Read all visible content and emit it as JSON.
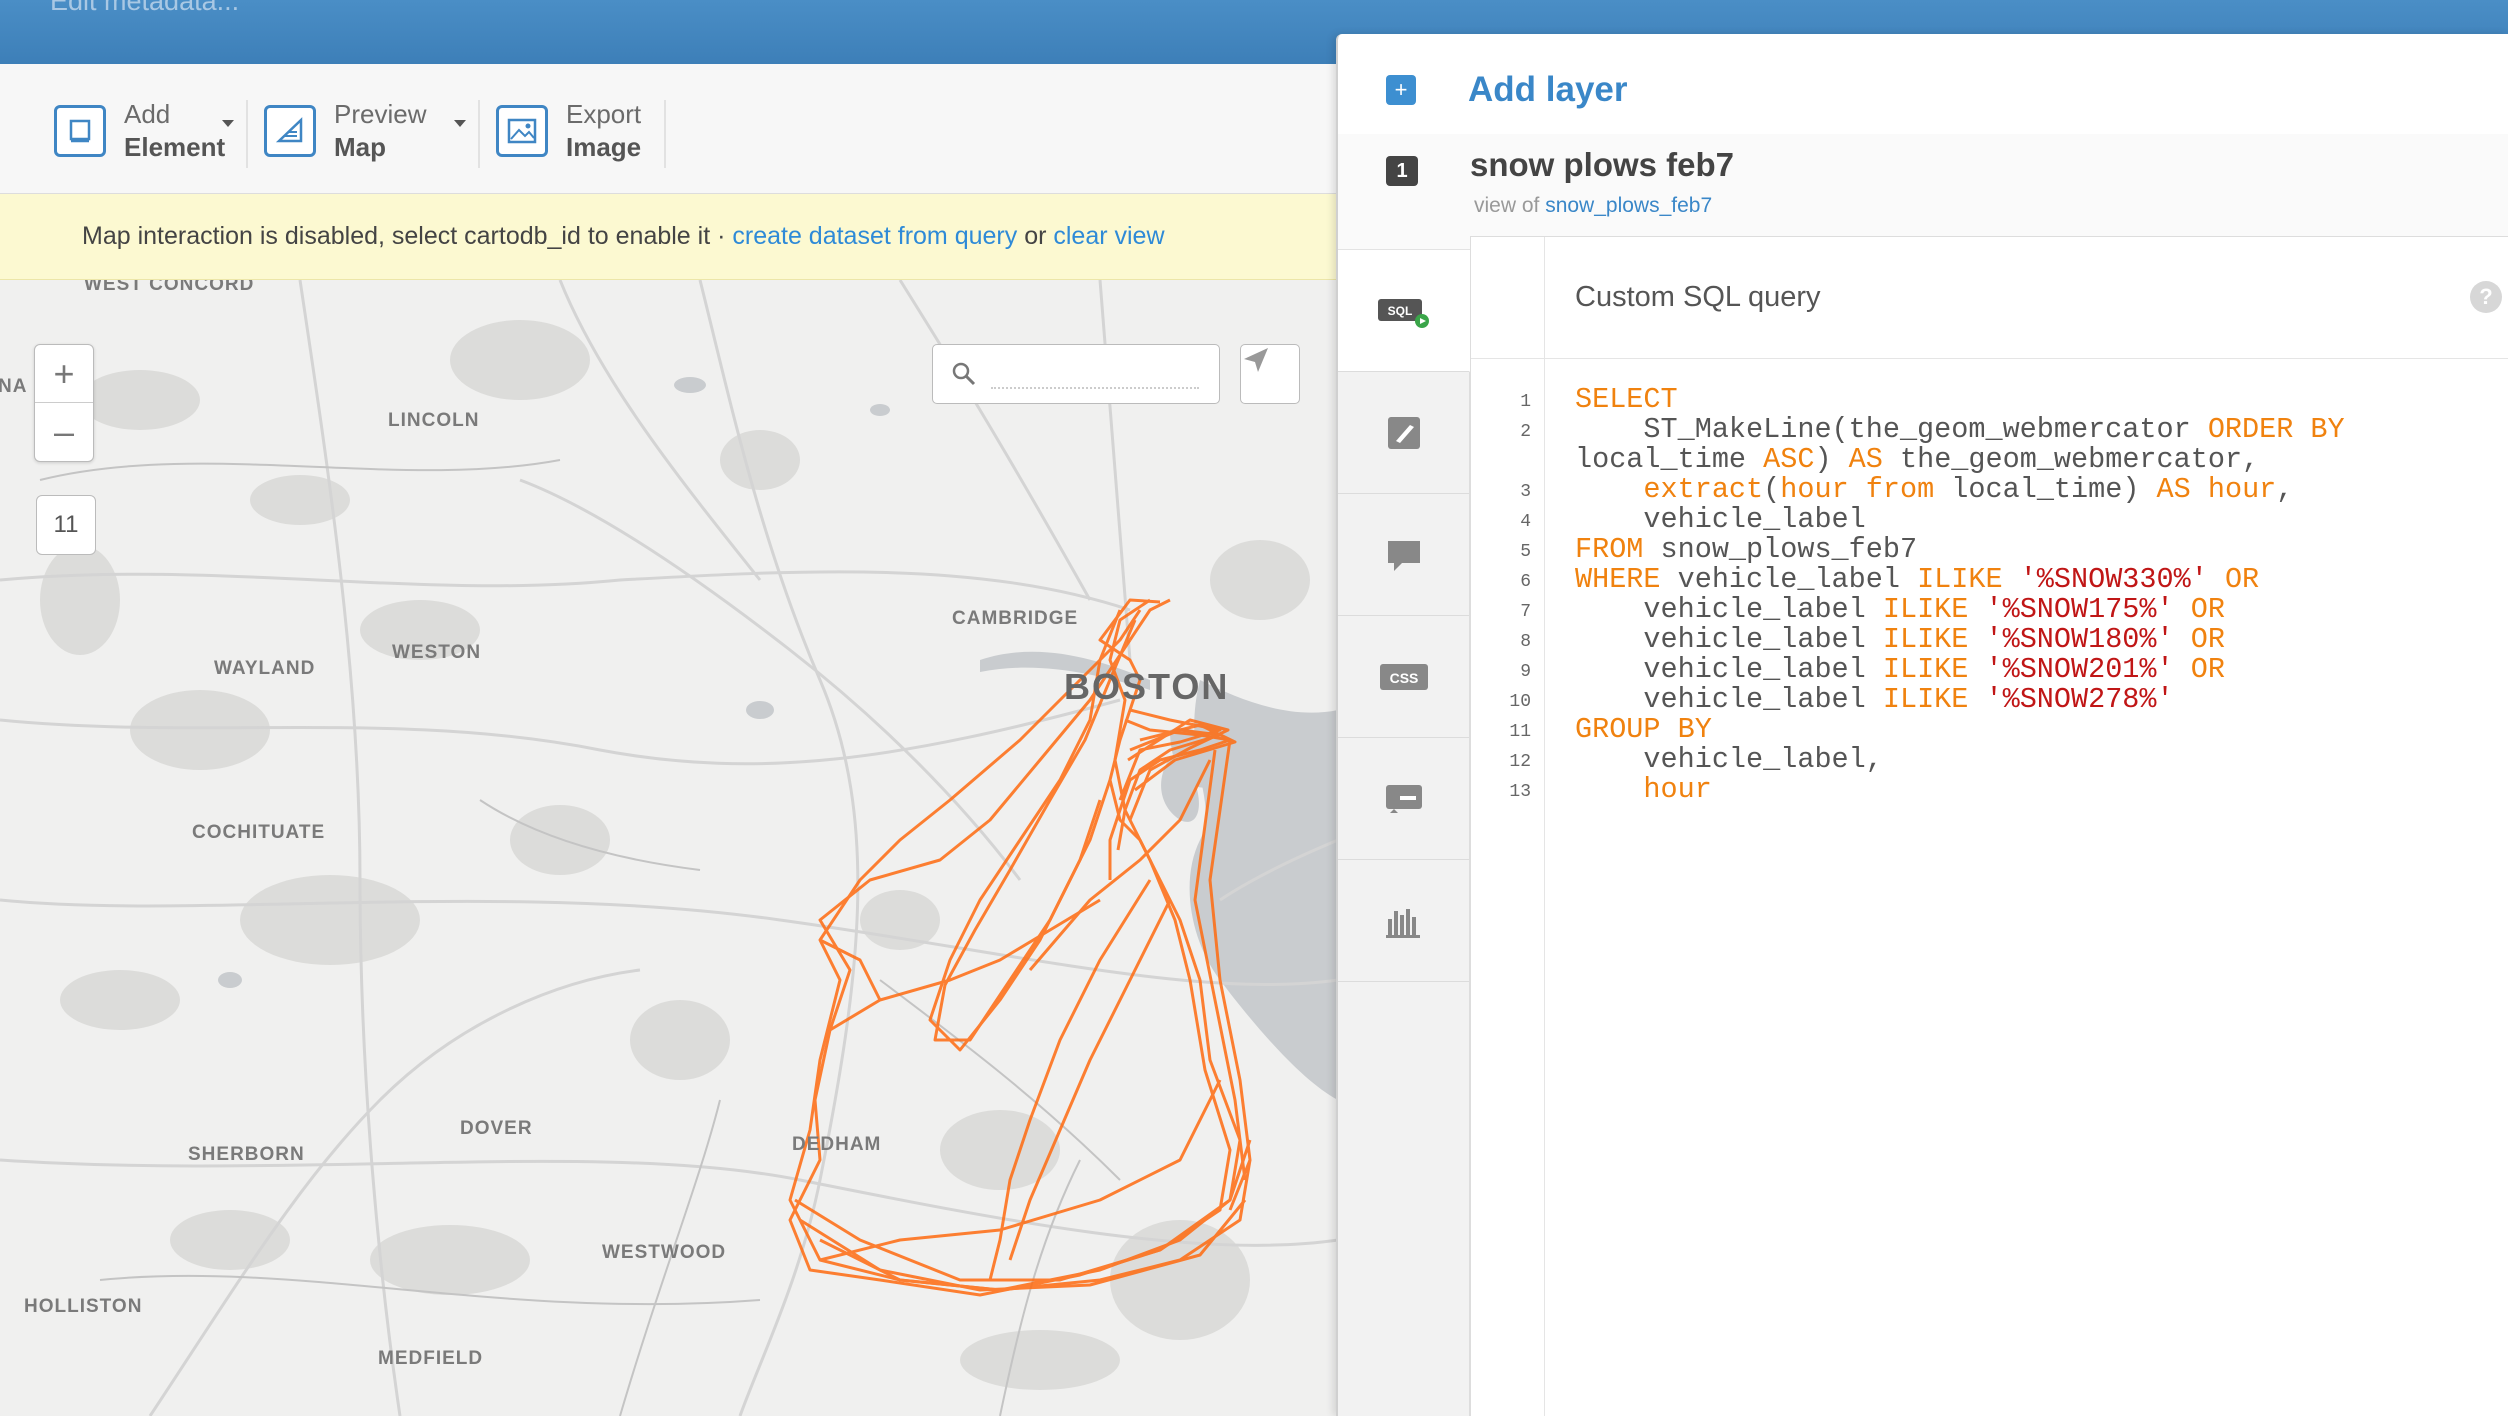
{
  "topbar": {
    "meta_label": "Edit metadata..."
  },
  "toolbar": {
    "add": {
      "line1": "Add",
      "line2": "Element"
    },
    "preview": {
      "line1": "Preview",
      "line2": "Map"
    },
    "export": {
      "line1": "Export",
      "line2": "Image"
    }
  },
  "notice": {
    "text": "Map interaction is disabled, select cartodb_id to enable it · ",
    "link1": "create dataset from query",
    "or": " or ",
    "link2": "clear view"
  },
  "map": {
    "zoom_in": "+",
    "zoom_out": "–",
    "zoom_level": "11",
    "route_color": "#ff6b10",
    "labels": {
      "west_concord": "WEST CONCORD",
      "lincoln": "LINCOLN",
      "cambridge": "CAMBRIDGE",
      "boston": "BOSTON",
      "wayland": "WAYLAND",
      "weston": "WESTON",
      "cochituate": "COCHITUATE",
      "dover": "DOVER",
      "dedham": "DEDHAM",
      "sherborn": "SHERBORN",
      "westwood": "WESTWOOD",
      "holliston": "HOLLISTON",
      "medfield": "MEDFIELD",
      "natick_partial": "NA"
    }
  },
  "panel": {
    "add_layer": "Add layer",
    "layer_number": "1",
    "layer_name": "snow plows feb7",
    "view_of_label": "view of",
    "view_of_link": "snow_plows_feb7",
    "section_title": "Custom SQL query",
    "help": "?",
    "sidebar_icons": [
      "sql-icon",
      "paintbrush-icon",
      "infowindow-icon",
      "css-icon",
      "legend-icon",
      "chart-icon"
    ],
    "sql_lines": [
      {
        "n": "1",
        "tokens": [
          [
            "kw",
            "SELECT"
          ]
        ]
      },
      {
        "n": "2",
        "tokens": [
          [
            "t",
            "    ST_MakeLine(the_geom_webmercator "
          ],
          [
            "kw",
            "ORDER BY"
          ]
        ]
      },
      {
        "n": "",
        "tokens": [
          [
            "t",
            "local_time "
          ],
          [
            "kw",
            "ASC"
          ],
          [
            "t",
            ") "
          ],
          [
            "kw",
            "AS"
          ],
          [
            "t",
            " the_geom_webmercator,"
          ]
        ]
      },
      {
        "n": "3",
        "tokens": [
          [
            "t",
            "    "
          ],
          [
            "kw",
            "extract"
          ],
          [
            "t",
            "("
          ],
          [
            "kw",
            "hour from"
          ],
          [
            "t",
            " local_time) "
          ],
          [
            "kw",
            "AS"
          ],
          [
            "t",
            " "
          ],
          [
            "kw",
            "hour"
          ],
          [
            "t",
            ","
          ]
        ]
      },
      {
        "n": "4",
        "tokens": [
          [
            "t",
            "    vehicle_label"
          ]
        ]
      },
      {
        "n": "5",
        "tokens": [
          [
            "kw",
            "FROM"
          ],
          [
            "t",
            " snow_plows_feb7"
          ]
        ]
      },
      {
        "n": "6",
        "tokens": [
          [
            "kw",
            "WHERE"
          ],
          [
            "t",
            " vehicle_label "
          ],
          [
            "kw",
            "ILIKE"
          ],
          [
            "t",
            " "
          ],
          [
            "str",
            "'%SNOW330%'"
          ],
          [
            "t",
            " "
          ],
          [
            "kw",
            "OR"
          ]
        ]
      },
      {
        "n": "7",
        "tokens": [
          [
            "t",
            "    vehicle_label "
          ],
          [
            "kw",
            "ILIKE"
          ],
          [
            "t",
            " "
          ],
          [
            "str",
            "'%SNOW175%'"
          ],
          [
            "t",
            " "
          ],
          [
            "kw",
            "OR"
          ]
        ]
      },
      {
        "n": "8",
        "tokens": [
          [
            "t",
            "    vehicle_label "
          ],
          [
            "kw",
            "ILIKE"
          ],
          [
            "t",
            " "
          ],
          [
            "str",
            "'%SNOW180%'"
          ],
          [
            "t",
            " "
          ],
          [
            "kw",
            "OR"
          ]
        ]
      },
      {
        "n": "9",
        "tokens": [
          [
            "t",
            "    vehicle_label "
          ],
          [
            "kw",
            "ILIKE"
          ],
          [
            "t",
            " "
          ],
          [
            "str",
            "'%SNOW201%'"
          ],
          [
            "t",
            " "
          ],
          [
            "kw",
            "OR"
          ]
        ]
      },
      {
        "n": "10",
        "tokens": [
          [
            "t",
            "    vehicle_label "
          ],
          [
            "kw",
            "ILIKE"
          ],
          [
            "t",
            " "
          ],
          [
            "str",
            "'%SNOW278%'"
          ]
        ]
      },
      {
        "n": "11",
        "tokens": [
          [
            "kw",
            "GROUP BY"
          ]
        ]
      },
      {
        "n": "12",
        "tokens": [
          [
            "t",
            "    vehicle_label,"
          ]
        ]
      },
      {
        "n": "13",
        "tokens": [
          [
            "t",
            "    "
          ],
          [
            "kw",
            "hour"
          ]
        ]
      }
    ]
  }
}
